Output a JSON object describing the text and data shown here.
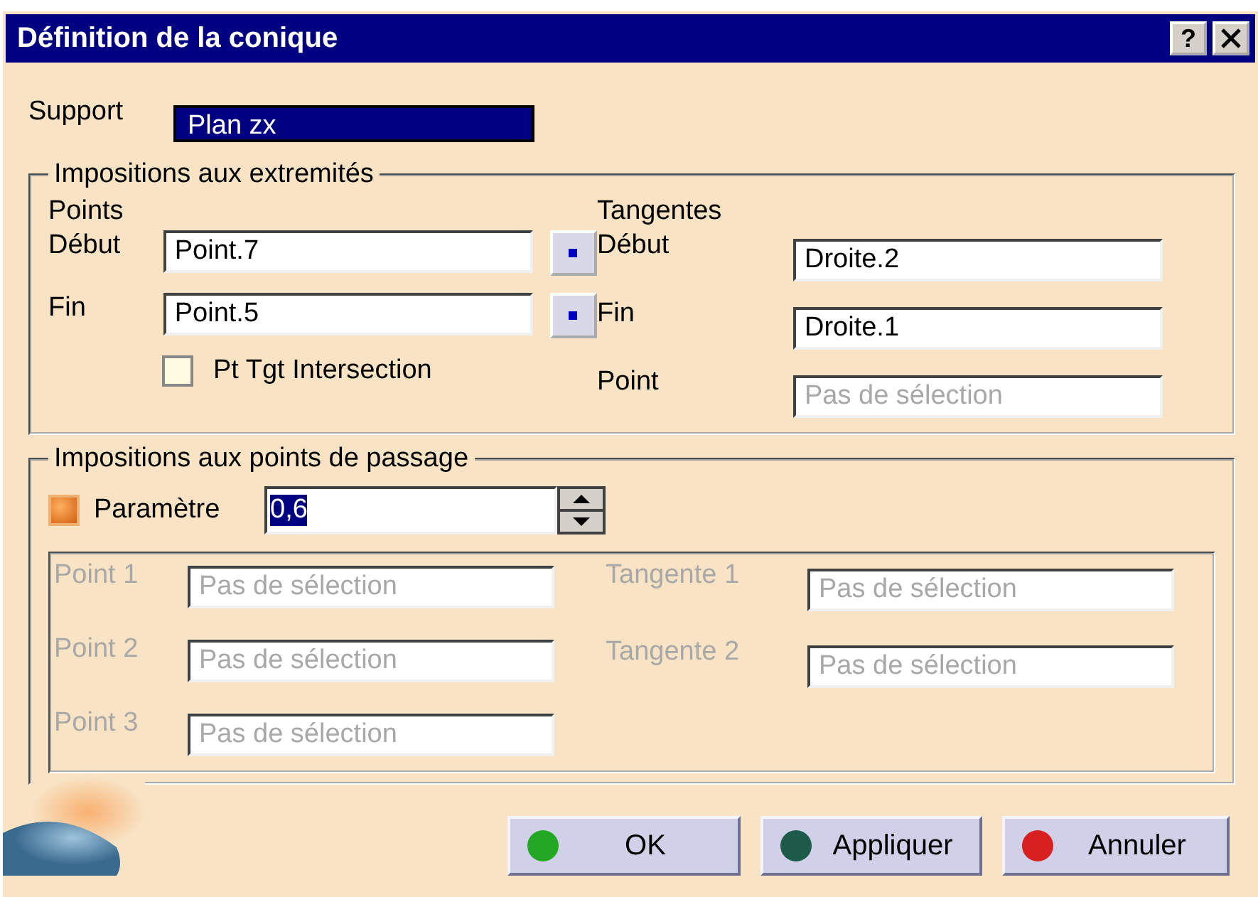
{
  "window": {
    "title": "Définition de la conique",
    "help": "?"
  },
  "support": {
    "label": "Support",
    "value": "Plan zx",
    "selected": true
  },
  "extremities": {
    "title": "Impositions aux extremités",
    "points": {
      "heading": "Points",
      "rows": [
        {
          "label": "Début",
          "value": "Point.7"
        },
        {
          "label": "Fin",
          "value": "Point.5"
        }
      ]
    },
    "intersection": {
      "label": "Pt Tgt Intersection",
      "checked": false
    },
    "tangents": {
      "heading": "Tangentes",
      "rows": [
        {
          "label": "Début",
          "value": "Droite.2"
        },
        {
          "label": "Fin",
          "value": "Droite.1"
        },
        {
          "label": "Point",
          "placeholder": "Pas de sélection"
        }
      ]
    }
  },
  "passage": {
    "title": "Impositions aux points de passage",
    "parameter": {
      "label": "Paramètre",
      "checked": true,
      "value": "0,6",
      "selected": true
    },
    "points": [
      {
        "label": "Point 1",
        "placeholder": "Pas de sélection",
        "disabled": true
      },
      {
        "label": "Point 2",
        "placeholder": "Pas de sélection",
        "disabled": true
      },
      {
        "label": "Point 3",
        "placeholder": "Pas de sélection",
        "disabled": true
      }
    ],
    "tangents": [
      {
        "label": "Tangente 1",
        "placeholder": "Pas de sélection",
        "disabled": true
      },
      {
        "label": "Tangente 2",
        "placeholder": "Pas de sélection",
        "disabled": true
      }
    ]
  },
  "buttons": [
    {
      "label": "OK",
      "color": "#22a822"
    },
    {
      "label": "Appliquer",
      "color": "#1e5a4a"
    },
    {
      "label": "Annuler",
      "color": "#d82020"
    }
  ]
}
